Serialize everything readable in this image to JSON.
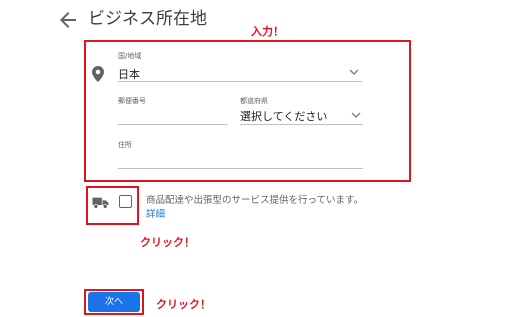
{
  "header": {
    "title": "ビジネス所在地"
  },
  "annotations": {
    "input_note": "入力！",
    "click_note_1": "クリック！",
    "click_note_2": "クリック！"
  },
  "form": {
    "country": {
      "label": "国/地域",
      "value": "日本"
    },
    "postal_code": {
      "label": "郵便番号",
      "value": ""
    },
    "prefecture": {
      "label": "都道府県",
      "value": "選択してください"
    },
    "address": {
      "label": "住所",
      "value": ""
    }
  },
  "delivery": {
    "checked": false,
    "text": "商品配達や出張型のサービス提供を行っています。",
    "link": "詳細"
  },
  "footer": {
    "next_label": "次へ"
  },
  "colors": {
    "annotation_red": "#e0141e",
    "primary_blue": "#1a73e8"
  }
}
